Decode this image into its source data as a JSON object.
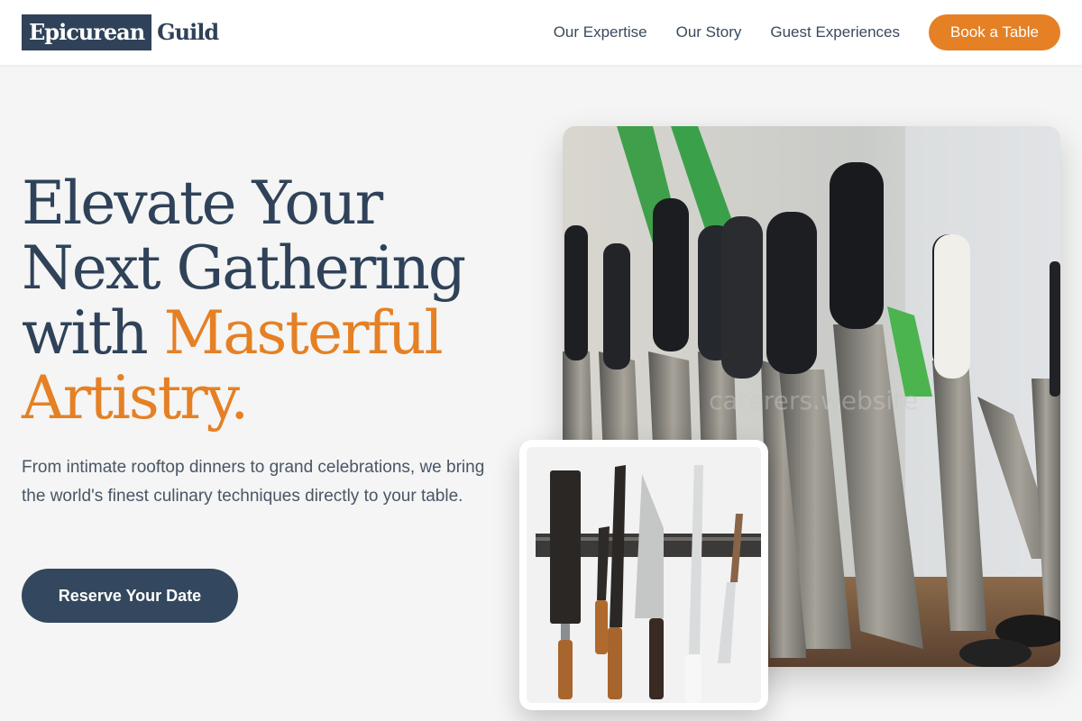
{
  "header": {
    "logo_primary": "Epicurean",
    "logo_secondary": "Guild",
    "nav": [
      "Our Expertise",
      "Our Story",
      "Guest Experiences"
    ],
    "cta_label": "Book a Table"
  },
  "hero": {
    "headline_line1": "Elevate Your",
    "headline_line2": "Next Gathering",
    "headline_line3_plain": "with",
    "headline_line3_accent": "Masterful",
    "headline_line4_accent": "Artistry.",
    "subtext": "From intimate rooftop dinners to grand celebrations, we bring the world's finest culinary techniques directly to your table.",
    "button_label": "Reserve Your Date"
  },
  "images": {
    "main_watermark": "caterers.website"
  },
  "colors": {
    "navy": "#2f4259",
    "accent": "#e58025",
    "background": "#f4f5f4"
  }
}
